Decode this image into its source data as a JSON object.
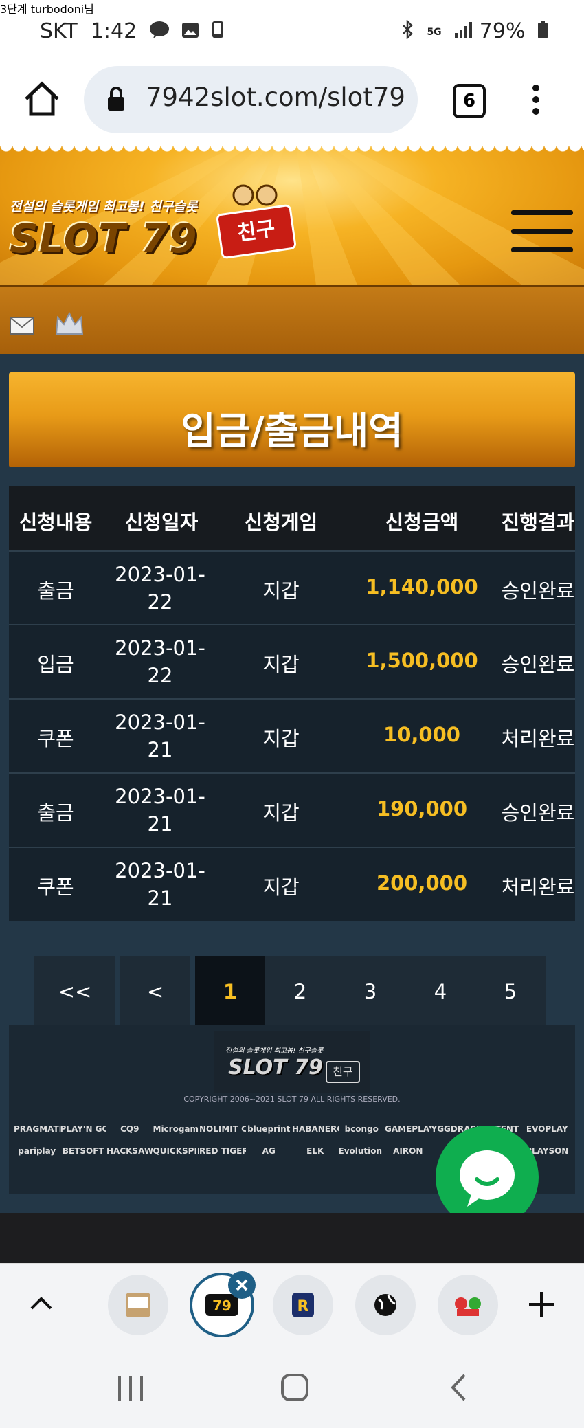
{
  "status": {
    "carrier": "SKT",
    "time": "1:42",
    "battery": "79%",
    "network": "5G"
  },
  "browser": {
    "url": "7942slot.com/slot79",
    "tab_count": "6"
  },
  "site": {
    "logo_tagline": "전설의 슬롯게임 최고봉! 친구슬롯",
    "logo_text": "SLOT 79",
    "logo_badge": "친구",
    "user_greeting": "3단계 turbodoni님"
  },
  "page": {
    "title": "입금/출금내역"
  },
  "table": {
    "headers": [
      "신청내용",
      "신청일자",
      "신청게임",
      "신청금액",
      "진행결과"
    ],
    "rows": [
      {
        "type": "출금",
        "date": "2023-01-22",
        "game": "지갑",
        "amount": "1,140,000",
        "result": "승인완료"
      },
      {
        "type": "입금",
        "date": "2023-01-22",
        "game": "지갑",
        "amount": "1,500,000",
        "result": "승인완료"
      },
      {
        "type": "쿠폰",
        "date": "2023-01-21",
        "game": "지갑",
        "amount": "10,000",
        "result": "처리완료"
      },
      {
        "type": "출금",
        "date": "2023-01-21",
        "game": "지갑",
        "amount": "190,000",
        "result": "승인완료"
      },
      {
        "type": "쿠폰",
        "date": "2023-01-21",
        "game": "지갑",
        "amount": "200,000",
        "result": "처리완료"
      }
    ]
  },
  "pagination": {
    "first": "<<",
    "prev": "<",
    "pages": [
      "1",
      "2",
      "3",
      "4",
      "5"
    ],
    "current": "1"
  },
  "footer": {
    "copyright": "COPYRIGHT 2006~2021 SLOT 79 ALL RIGHTS RESERVED.",
    "providers_row1": [
      "PRAGMATIC PLAY",
      "PLAY'N GO",
      "CQ9",
      "Microgaming",
      "NOLIMIT CITY",
      "blueprint",
      "HABANERO",
      "bcongo",
      "GAMEPLAY",
      "YGGDRASIL",
      "NETENT",
      "EVOPLAY"
    ],
    "providers_row2": [
      "pariplay",
      "BETSOFT",
      "HACKSAW GAMING",
      "QUICKSPIN",
      "RED TIGER",
      "AG",
      "ELK",
      "Evolution Gaming",
      "AIRON",
      "",
      "",
      "PLAYSON"
    ]
  },
  "colors": {
    "accent": "#f6be23",
    "header_gold": "#e69810",
    "bg": "#233747",
    "chat_green": "#0fae4f"
  }
}
